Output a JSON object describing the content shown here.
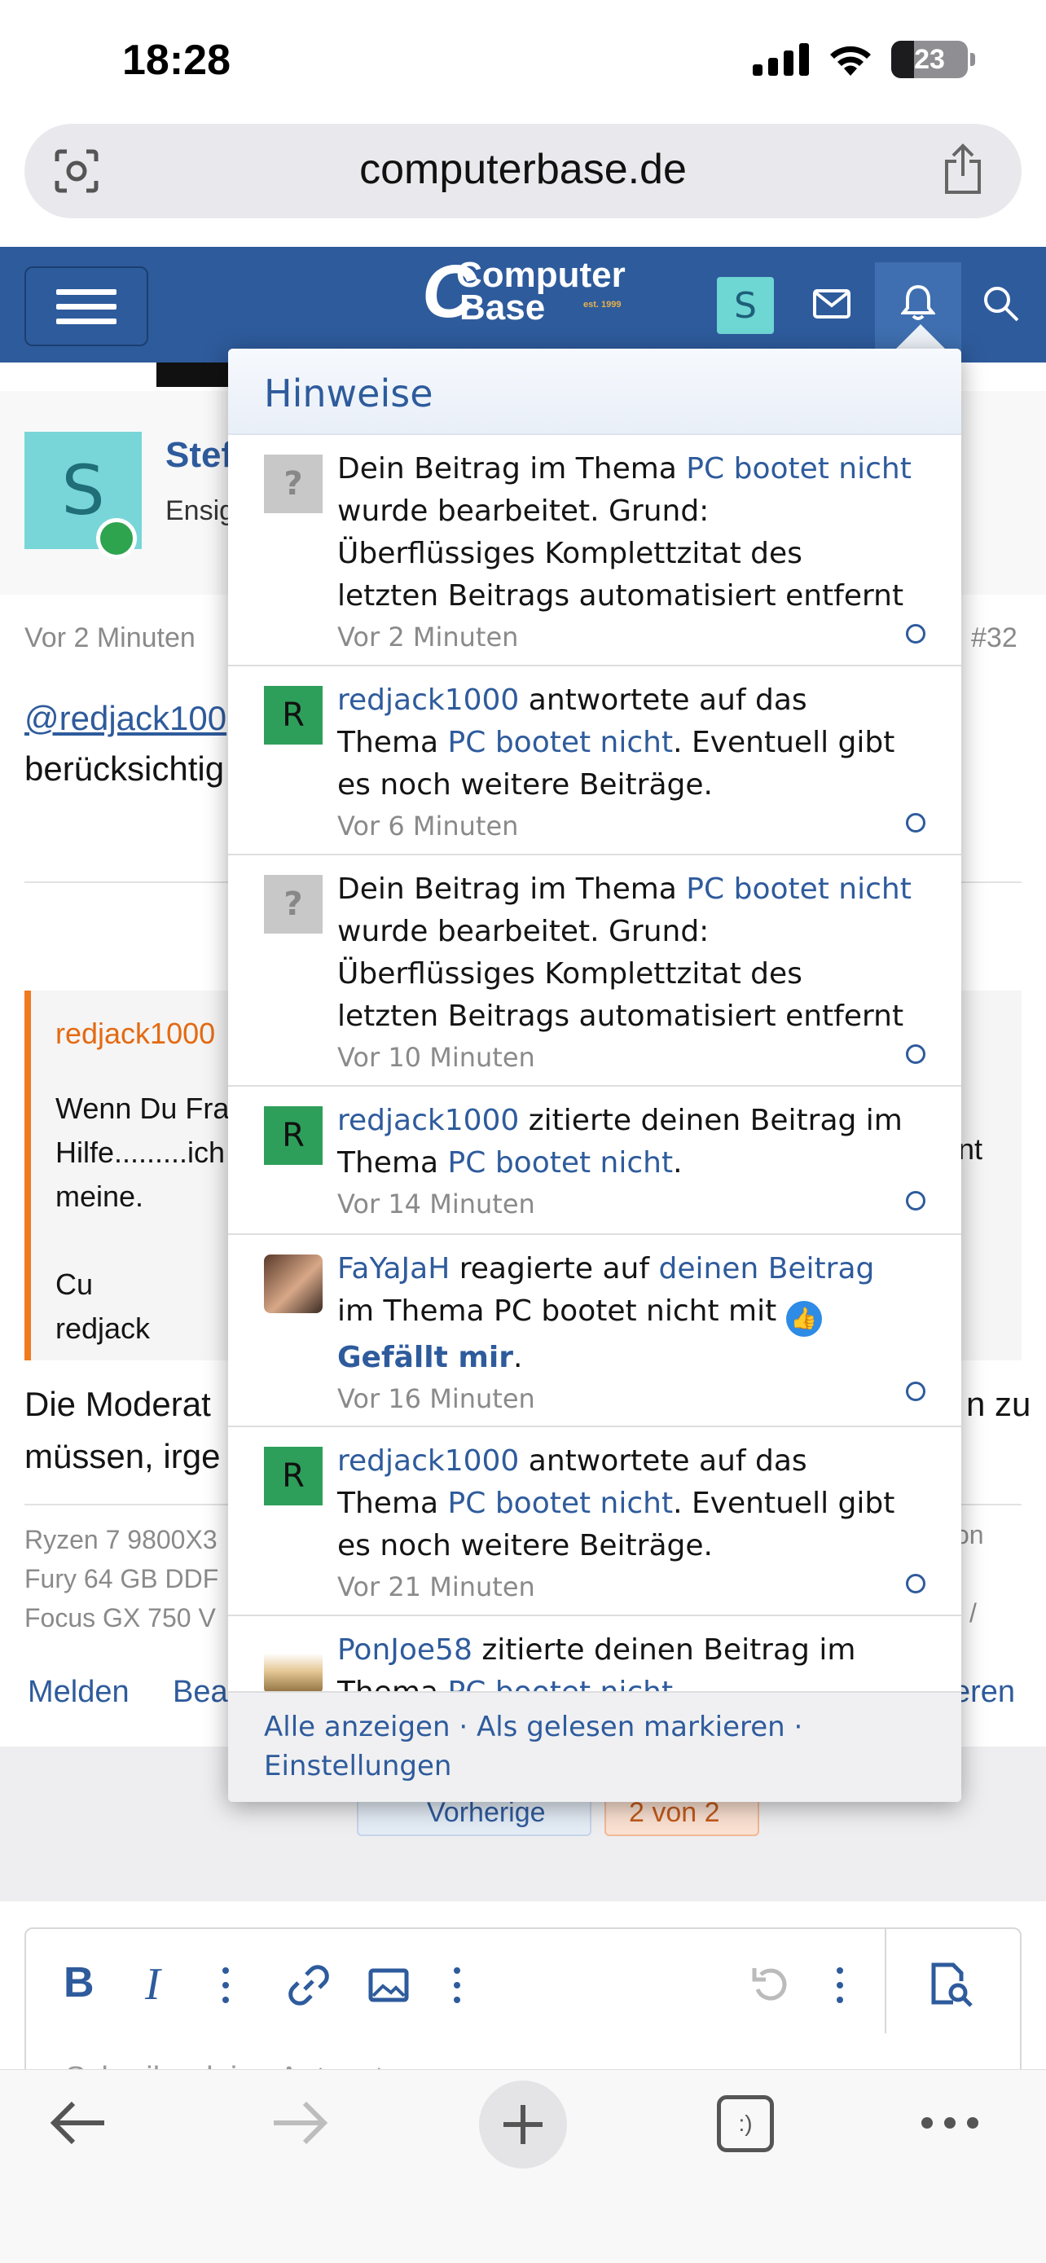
{
  "status": {
    "time": "18:28",
    "battery": "23"
  },
  "browser": {
    "url": "computerbase.de"
  },
  "site": {
    "logo_top": "Computer",
    "logo_bottom": "Base",
    "logo_est": "est. 1999",
    "user_initial": "S"
  },
  "post": {
    "author_initial": "S",
    "author_name_partial": "Stef",
    "author_role_partial": "Ensig",
    "time": "Vor 2 Minuten",
    "number": "#32",
    "mention_partial": "@redjack100",
    "text_partial": "berücksichtig"
  },
  "quote": {
    "author_partial": "redjack1000",
    "lines": [
      "Wenn Du Fra",
      "Hilfe.........ich",
      "meine.",
      "",
      "Cu",
      "redjack"
    ],
    "right_fragment": "nt"
  },
  "after_quote": {
    "line1": "Die Moderat",
    "line1_right": "n zu",
    "line2": "müssen, irge"
  },
  "signature": {
    "lines": [
      "Ryzen 7 9800X3",
      "Fury 64 GB DDF",
      "Focus GX 750 V"
    ],
    "right1": "on",
    "right3": "/"
  },
  "actions": {
    "report": "Melden",
    "edit_partial": "Bea",
    "right_partial": "eren"
  },
  "pagination": {
    "prev": "Vorherige",
    "pages": "2 von 2"
  },
  "notifications": {
    "title": "Hinweise",
    "items": [
      {
        "icon": "?",
        "pre": "Dein Beitrag im Thema ",
        "link1": "PC bootet nicht",
        "post": " wurde bearbeitet. Grund: Überflüssiges Komplettzitat des letzten Beitrags automatisiert entfernt",
        "time": "Vor 2 Minuten"
      },
      {
        "icon": "R",
        "user": "redjack1000",
        "pre": " antwortete auf das Thema ",
        "link1": "PC bootet nicht",
        "post": ". Eventuell gibt es noch weitere Beiträge.",
        "time": "Vor 6 Minuten"
      },
      {
        "icon": "?",
        "pre": "Dein Beitrag im Thema ",
        "link1": "PC bootet nicht",
        "post": " wurde bearbeitet. Grund: Überflüssiges Komplettzitat des letzten Beitrags automatisiert entfernt",
        "time": "Vor 10 Minuten"
      },
      {
        "icon": "R",
        "user": "redjack1000",
        "pre": " zitierte deinen Beitrag im Thema ",
        "link1": "PC bootet nicht",
        "post": ".",
        "time": "Vor 14 Minuten"
      },
      {
        "user": "FaYaJaH",
        "pre": " reagierte auf ",
        "link1": "deinen Beitrag",
        "mid": " im Thema PC bootet nicht mit ",
        "reaction": "Gefällt mir",
        "post": ".",
        "time": "Vor 16 Minuten"
      },
      {
        "icon": "R",
        "user": "redjack1000",
        "pre": " antwortete auf das Thema ",
        "link1": "PC bootet nicht",
        "post": ". Eventuell gibt es noch weitere Beiträge.",
        "time": "Vor 21 Minuten"
      },
      {
        "user": "PonJoe58",
        "pre": " zitierte deinen Beitrag im ",
        "post": "Thema ",
        "link1": "PC bootet nicht"
      }
    ],
    "footer": {
      "show_all": "Alle anzeigen",
      "mark_read": "Als gelesen markieren",
      "settings": "Einstellungen",
      "sep": " · "
    }
  },
  "editor": {
    "placeholder_partial": "Schreibe deine Antwort..."
  },
  "colors": {
    "brand": "#2e5b9c",
    "accent_orange": "#f07a1e",
    "online": "#2ea44f"
  }
}
